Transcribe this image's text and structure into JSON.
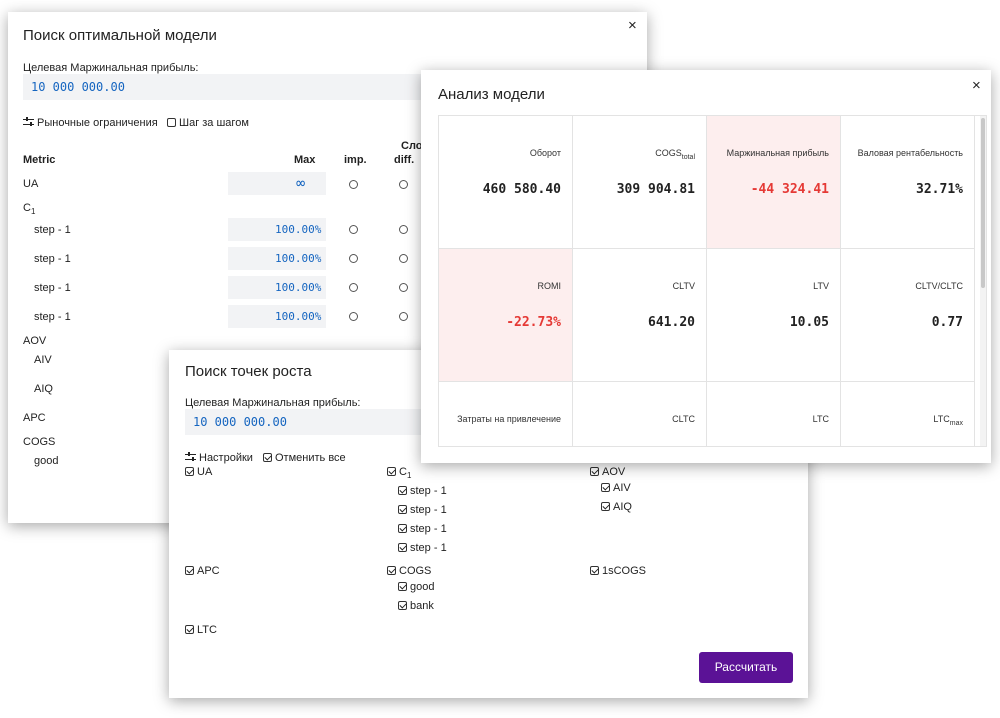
{
  "dialog1": {
    "title": "Поиск оптимальной модели",
    "close": "×",
    "target_label": "Целевая Маржинальная прибыль:",
    "target_value": "10 000 000.00",
    "market_constraints": "Рыночные ограничения",
    "step_by_step": "Шаг за шагом",
    "col_metric": "Metric",
    "col_max": "Max",
    "col_imp": "imp.",
    "col_diff_top": "Сло",
    "col_diff": "diff.",
    "rows": {
      "ua": "UA",
      "ua_max": "∞",
      "c1": "C",
      "c1_sub": "1",
      "steps": [
        {
          "label": "step - 1",
          "max": "100.00%"
        },
        {
          "label": "step - 1",
          "max": "100.00%"
        },
        {
          "label": "step - 1",
          "max": "100.00%"
        },
        {
          "label": "step - 1",
          "max": "100.00%"
        }
      ],
      "aov": "AOV",
      "aiv": "AIV",
      "aiq": "AIQ",
      "apc": "APC",
      "cogs": "COGS",
      "good": "good"
    }
  },
  "dialog2": {
    "title": "Поиск точек роста",
    "target_label": "Целевая Маржинальная прибыль:",
    "target_value": "10 000 000.00",
    "settings": "Настройки",
    "cancel_all": "Отменить все",
    "items": {
      "ua": "UA",
      "c1": "C",
      "c1_sub": "1",
      "steps": [
        "step - 1",
        "step - 1",
        "step - 1",
        "step - 1"
      ],
      "aov": "AOV",
      "aiv": "AIV",
      "aiq": "AIQ",
      "apc": "APC",
      "cogs": "COGS",
      "good": "good",
      "bank": "bank",
      "one_s_cogs": "1sCOGS",
      "ltc": "LTC"
    },
    "calc_button": "Рассчитать"
  },
  "dialog3": {
    "title": "Анализ модели",
    "close": "×",
    "cells": [
      {
        "title": "Оборот",
        "sub": "",
        "value": "460 580.40",
        "negative": false
      },
      {
        "title": "COGS",
        "sub": "total",
        "value": "309 904.81",
        "negative": false
      },
      {
        "title": "Маржинальная прибыль",
        "sub": "",
        "value": "-44 324.41",
        "negative": true
      },
      {
        "title": "Валовая рентабельность",
        "sub": "",
        "value": "32.71%",
        "negative": false
      },
      {
        "title": "ROMI",
        "sub": "",
        "value": "-22.73%",
        "negative": true
      },
      {
        "title": "CLTV",
        "sub": "",
        "value": "641.20",
        "negative": false
      },
      {
        "title": "LTV",
        "sub": "",
        "value": "10.05",
        "negative": false
      },
      {
        "title": "CLTV/CLTC",
        "sub": "",
        "value": "0.77",
        "negative": false
      },
      {
        "title": "Затраты на привлечение",
        "sub": "",
        "value": "",
        "negative": false
      },
      {
        "title": "CLTC",
        "sub": "",
        "value": "",
        "negative": false
      },
      {
        "title": "LTC",
        "sub": "",
        "value": "",
        "negative": false
      },
      {
        "title": "LTC",
        "sub": "max",
        "value": "",
        "negative": false
      }
    ]
  },
  "colors": {
    "accent_button": "#5b1296",
    "value_blue": "#1565c0",
    "negative_red": "#e53935",
    "negative_bg": "#fdeeee"
  }
}
